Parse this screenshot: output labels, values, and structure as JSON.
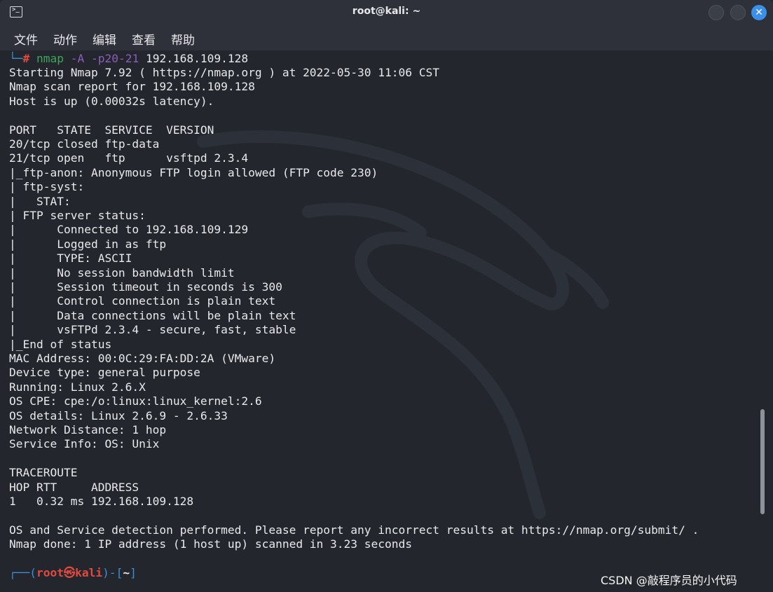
{
  "window": {
    "title": "root@kali: ~",
    "close_glyph": "✕",
    "app_icon_glyph": ">_"
  },
  "menu": [
    "文件",
    "动作",
    "编辑",
    "查看",
    "帮助"
  ],
  "command": {
    "prefix": "└─",
    "hash": "#",
    "name": "nmap",
    "flags": "-A -p20-21",
    "target": "192.168.109.128"
  },
  "output": [
    "Starting Nmap 7.92 ( https://nmap.org ) at 2022-05-30 11:06 CST",
    "Nmap scan report for 192.168.109.128",
    "Host is up (0.00032s latency).",
    "",
    "PORT   STATE  SERVICE  VERSION",
    "20/tcp closed ftp-data",
    "21/tcp open   ftp      vsftpd 2.3.4",
    "|_ftp-anon: Anonymous FTP login allowed (FTP code 230)",
    "| ftp-syst: ",
    "|   STAT: ",
    "| FTP server status:",
    "|      Connected to 192.168.109.129",
    "|      Logged in as ftp",
    "|      TYPE: ASCII",
    "|      No session bandwidth limit",
    "|      Session timeout in seconds is 300",
    "|      Control connection is plain text",
    "|      Data connections will be plain text",
    "|      vsFTPd 2.3.4 - secure, fast, stable",
    "|_End of status",
    "MAC Address: 00:0C:29:FA:DD:2A (VMware)",
    "Device type: general purpose",
    "Running: Linux 2.6.X",
    "OS CPE: cpe:/o:linux:linux_kernel:2.6",
    "OS details: Linux 2.6.9 - 2.6.33",
    "Network Distance: 1 hop",
    "Service Info: OS: Unix",
    "",
    "TRACEROUTE",
    "HOP RTT     ADDRESS",
    "1   0.32 ms 192.168.109.128",
    "",
    "OS and Service detection performed. Please report any incorrect results at https://nmap.org/submit/ .",
    "Nmap done: 1 IP address (1 host up) scanned in 3.23 seconds"
  ],
  "prompt": {
    "open": "┌──(",
    "user": "root㉿kali",
    "mid": ")-[",
    "dir": "~",
    "close": "]"
  },
  "watermark": "CSDN @敲程序员的小代码",
  "colors": {
    "background": "#23262d",
    "titlebar": "#2e3139",
    "accent_blue": "#3b8ed8",
    "prompt_red": "#e04a3f",
    "command_green": "#3fa55a",
    "flag_purple": "#8a5fb8"
  }
}
